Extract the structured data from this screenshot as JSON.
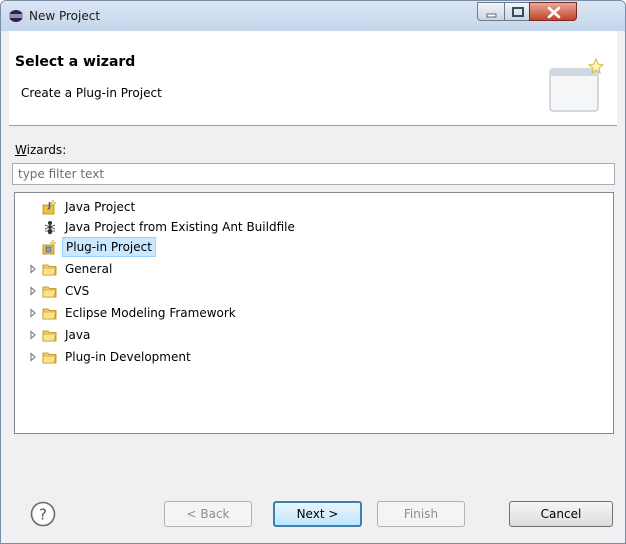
{
  "window": {
    "title": "New Project"
  },
  "banner": {
    "title": "Select a wizard",
    "description": "Create a Plug-in Project"
  },
  "wizards": {
    "label_mnemonic": "W",
    "label_rest": "izards:",
    "filter_placeholder": "type filter text"
  },
  "tree": [
    {
      "label": "Java Project",
      "icon": "java-project-icon",
      "type": "leaf",
      "selected": false
    },
    {
      "label": "Java Project from Existing Ant Buildfile",
      "icon": "ant-icon",
      "type": "leaf",
      "selected": false
    },
    {
      "label": "Plug-in Project",
      "icon": "plugin-project-icon",
      "type": "leaf",
      "selected": true
    },
    {
      "label": "General",
      "icon": "folder-icon",
      "type": "folder",
      "expanded": false
    },
    {
      "label": "CVS",
      "icon": "folder-icon",
      "type": "folder",
      "expanded": false
    },
    {
      "label": "Eclipse Modeling Framework",
      "icon": "folder-icon",
      "type": "folder",
      "expanded": false
    },
    {
      "label": "Java",
      "icon": "folder-icon",
      "type": "folder",
      "expanded": false
    },
    {
      "label": "Plug-in Development",
      "icon": "folder-icon",
      "type": "folder",
      "expanded": false
    }
  ],
  "buttons": {
    "back": "< Back",
    "next": "Next >",
    "finish": "Finish",
    "cancel": "Cancel"
  },
  "colors": {
    "selection": "#cce8ff",
    "folder": "#f0c040",
    "default_button_border": "#3c7fb1"
  }
}
